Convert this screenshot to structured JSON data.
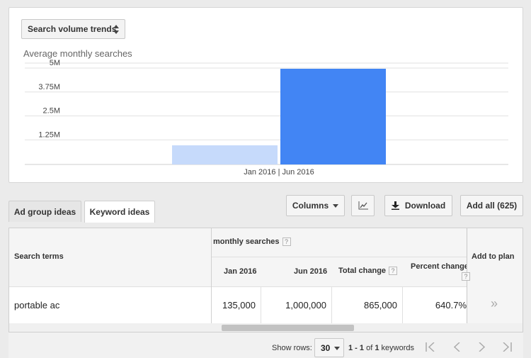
{
  "trend_selector": {
    "label": "Search volume trends"
  },
  "chart_data": {
    "type": "bar",
    "title": "Average monthly searches",
    "categories": [
      "Jan 2016",
      "Jun 2016"
    ],
    "values": [
      1000000,
      5000000
    ],
    "bar_colors": [
      "#c6dafb",
      "#4285f4"
    ],
    "x_tick_label": "Jan 2016 | Jun 2016",
    "y_ticks": [
      "5M",
      "3.75M",
      "2.5M",
      "1.25M"
    ],
    "y_tick_values": [
      5000000,
      3750000,
      2500000,
      1250000
    ],
    "ylim": [
      0,
      5000000
    ],
    "grid": true
  },
  "tabs": [
    {
      "label": "Ad group ideas",
      "active": false
    },
    {
      "label": "Keyword ideas",
      "active": true
    }
  ],
  "toolbar": {
    "columns_label": "Columns",
    "download_label": "Download",
    "add_all_label": "Add all (625)"
  },
  "table": {
    "col_search_terms": "Search terms",
    "group_monthly": "monthly searches",
    "col_jan": "Jan 2016",
    "col_jun": "Jun 2016",
    "col_total": "Total change",
    "col_percent": "Percent change",
    "col_add": "Add to plan",
    "help_mark": "?",
    "rows": [
      {
        "term": "portable ac",
        "jan": "135,000",
        "jun": "1,000,000",
        "total": "865,000",
        "percent": "640.7%",
        "add": "»"
      }
    ]
  },
  "footer": {
    "show_rows_label": "Show rows:",
    "rows_value": "30",
    "range_prefix": "1 - 1",
    "range_of": "of",
    "range_count": "1",
    "range_suffix": "keywords"
  },
  "colors": {
    "accent": "#4285f4",
    "light_bar": "#c6dafb"
  }
}
